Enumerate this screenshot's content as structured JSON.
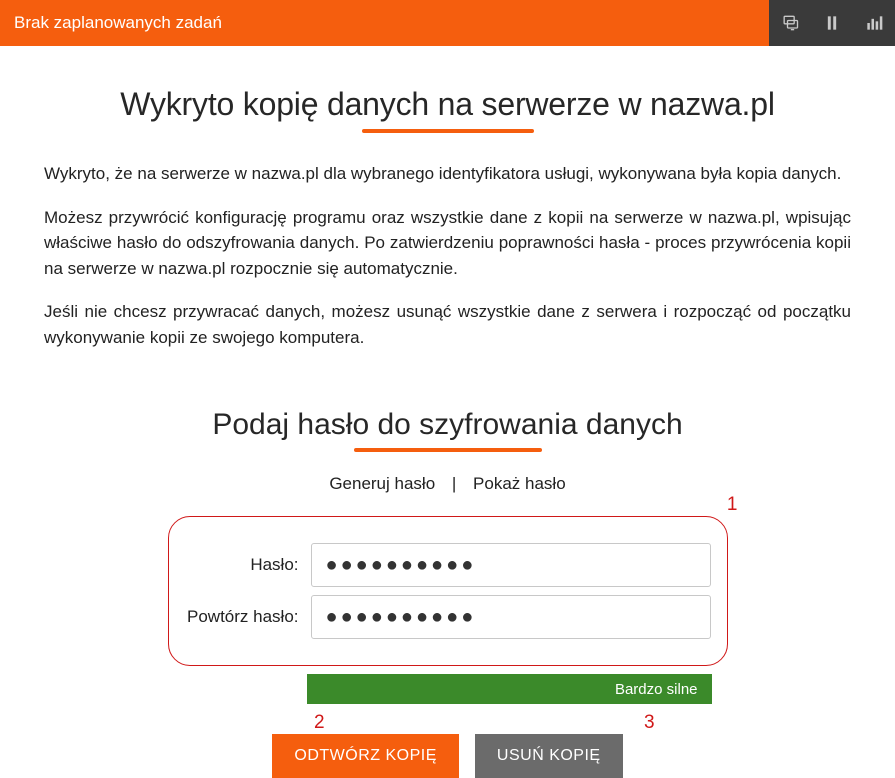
{
  "topbar": {
    "status": "Brak zaplanowanych zadań"
  },
  "title": "Wykryto kopię danych na serwerze w nazwa.pl",
  "paragraphs": {
    "p1": "Wykryto, że na serwerze w nazwa.pl dla wybranego identyfikatora usługi, wykonywana była kopia danych.",
    "p2": "Możesz przywrócić konfigurację programu oraz wszystkie dane z kopii na serwerze w nazwa.pl, wpisując właściwe hasło do odszyfrowania danych. Po zatwierdzeniu poprawności hasła - proces przywrócenia kopii na serwerze w nazwa.pl rozpocznie się automatycznie.",
    "p3": "Jeśli nie chcesz przywracać danych, możesz usunąć wszystkie dane z serwera i rozpocząć od początku wykonywanie kopii ze swojego komputera."
  },
  "subtitle": "Podaj hasło do szyfrowania danych",
  "tools": {
    "generate": "Generuj hasło",
    "show": "Pokaż hasło",
    "sep": "|"
  },
  "labels": {
    "password": "Hasło:",
    "repeat": "Powtórz hasło:"
  },
  "fields": {
    "password": "●●●●●●●●●●",
    "repeat": "●●●●●●●●●●"
  },
  "strength": {
    "label": "Bardzo silne",
    "color": "#3b8a2a"
  },
  "buttons": {
    "restore": "ODTWÓRZ KOPIĘ",
    "delete": "USUŃ KOPIĘ"
  },
  "annotations": {
    "a1": "1",
    "a2": "2",
    "a3": "3"
  },
  "colors": {
    "accent": "#f55e0e",
    "topbar_icons_bg": "#3a3a3a",
    "danger": "#d01818"
  }
}
